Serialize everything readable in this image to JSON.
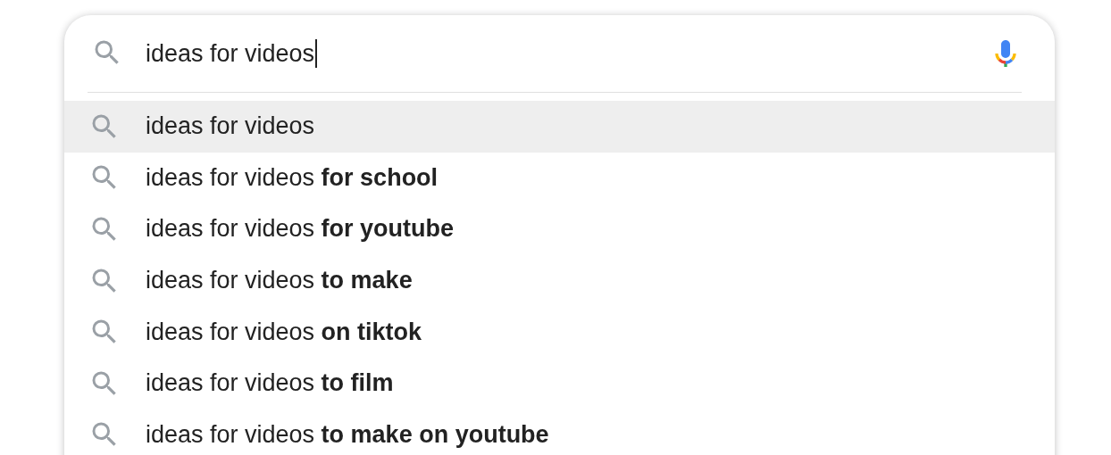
{
  "search": {
    "value": "ideas for videos"
  },
  "suggestions": [
    {
      "text": "ideas for videos",
      "selected": true
    },
    {
      "text": "ideas for videos **for school**",
      "selected": false
    },
    {
      "text": "ideas for videos **for youtube**",
      "selected": false
    },
    {
      "text": "ideas for videos **to make**",
      "selected": false
    },
    {
      "text": "ideas for videos **on tiktok**",
      "selected": false
    },
    {
      "text": "ideas for videos **to film**",
      "selected": false
    },
    {
      "text": "ideas for videos **to make on youtube**",
      "selected": false
    }
  ]
}
